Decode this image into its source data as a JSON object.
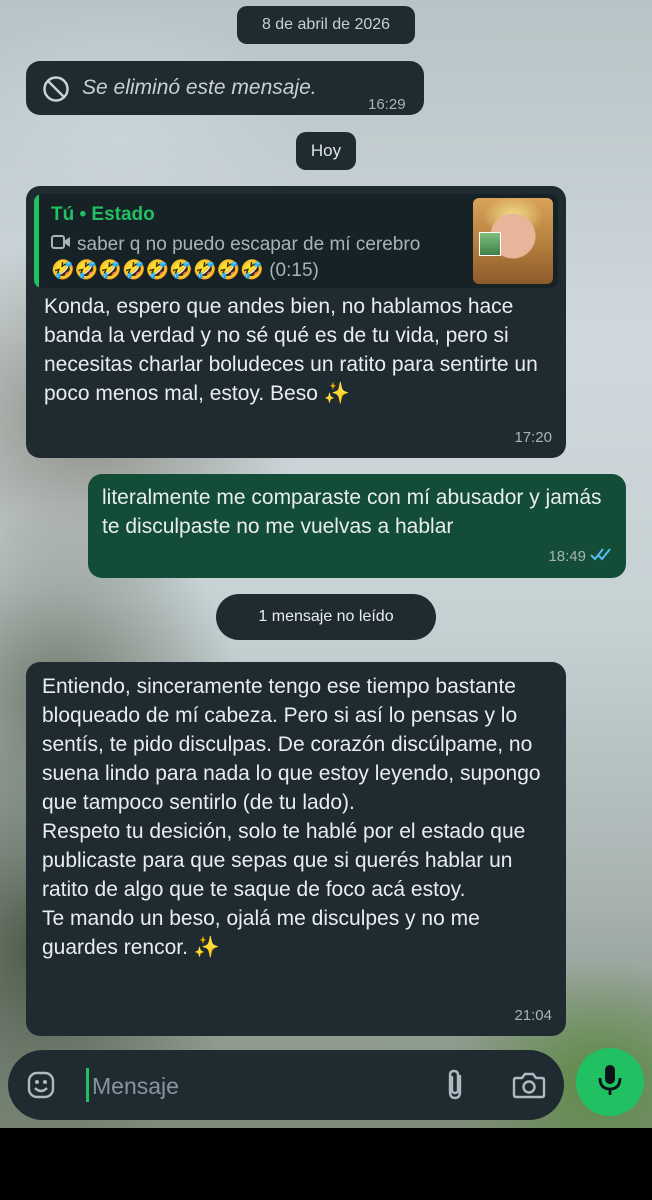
{
  "date_separator": "8 de abril de 2026",
  "deleted_message": {
    "text": "Se eliminó este mensaje.",
    "time": "16:29"
  },
  "today_separator": "Hoy",
  "message1": {
    "quote_author": "Tú • Estado",
    "quote_text": "saber q no puedo escapar de mí cerebro",
    "quote_emojis": "🤣🤣🤣🤣🤣🤣🤣🤣🤣",
    "quote_duration": "(0:15)",
    "text": "Konda, espero que andes bien, no hablamos hace banda la verdad y no sé qué es de tu vida, pero si necesitas charlar boludeces un ratito para sentirte un poco menos mal, estoy. Beso ✨",
    "time": "17:20"
  },
  "message2": {
    "text": "literalmente me comparaste con mí abusador y jamás te disculpaste no me vuelvas a hablar",
    "time": "18:49"
  },
  "unread_separator": "1 mensaje no leído",
  "message3": {
    "text": "Entiendo, sinceramente tengo ese tiempo bastante bloqueado de mí cabeza. Pero si así lo pensas y lo sentís, te pido disculpas. De corazón discúlpame, no suena lindo para nada lo que estoy leyendo, supongo que tampoco sentirlo (de tu lado).\nRespeto tu desición, solo te hablé por el estado que publicaste para que sepas que si querés hablar un ratito de algo que te saque de foco acá estoy.\nTe mando un beso, ojalá me disculpes y no me guardes rencor. ✨",
    "time": "21:04"
  },
  "composer": {
    "placeholder": "Mensaje"
  },
  "colors": {
    "incoming_bubble": "#1f2b30",
    "outgoing_bubble": "#144d37",
    "accent_green": "#21c063",
    "read_ticks": "#53bdeb"
  },
  "icons": {
    "deleted": "block-icon",
    "quote_video": "video-icon",
    "read_status": "double-check-icon",
    "emoji": "emoji-icon",
    "attach": "paperclip-icon",
    "camera": "camera-icon",
    "mic": "mic-icon"
  }
}
